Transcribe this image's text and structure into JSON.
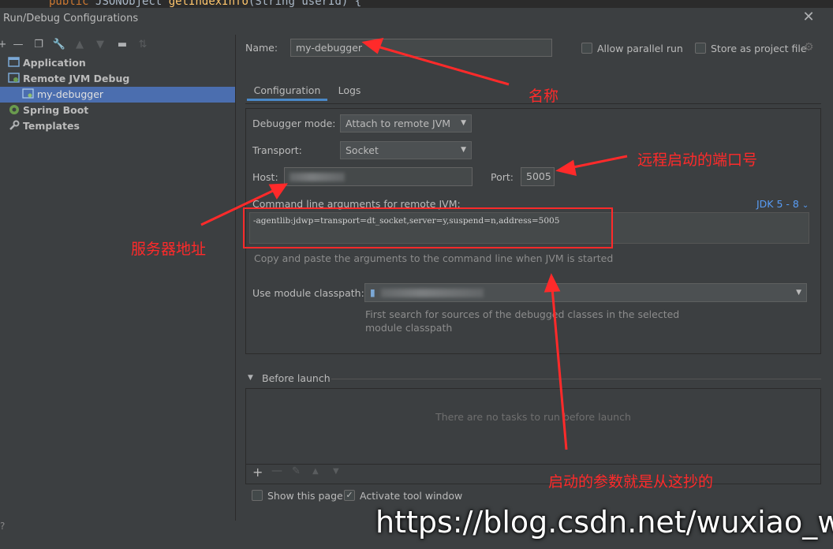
{
  "code_line": {
    "kw": "public",
    "type": "JSONObject",
    "fn": "getIndexInfo",
    "args": "(String userId) {"
  },
  "window": {
    "title": "Run/Debug Configurations"
  },
  "toolbar": {
    "icons": [
      "add-icon",
      "remove-icon",
      "copy-icon",
      "wrench-icon",
      "arrow-up-icon",
      "arrow-down-icon",
      "folder-icon",
      "sort-icon"
    ]
  },
  "tree": [
    {
      "label": "Application"
    },
    {
      "label": "Remote JVM Debug"
    },
    {
      "label": "my-debugger"
    },
    {
      "label": "Spring Boot"
    },
    {
      "label": "Templates"
    }
  ],
  "form": {
    "name_label": "Name:",
    "name_value": "my-debugger",
    "allow_parallel": "Allow parallel run",
    "store_project": "Store as project file",
    "tabs": [
      "Configuration",
      "Logs"
    ],
    "debugger_mode_label": "Debugger mode:",
    "debugger_mode_value": "Attach to remote JVM",
    "transport_label": "Transport:",
    "transport_value": "Socket",
    "host_label": "Host:",
    "port_label": "Port:",
    "port_value": "5005",
    "cmd_label": "Command line arguments for remote JVM:",
    "jdk_label": "JDK 5 - 8",
    "cmd_value": "-agentlib:jdwp=transport=dt_socket,server=y,suspend=n,address=5005",
    "cmd_hint": "Copy and paste the arguments to the command line when JVM is started",
    "module_label": "Use module classpath:",
    "module_hint_1": "First search for sources of the debugged classes in the selected",
    "module_hint_2": "module classpath",
    "before_launch": "Before launch",
    "no_tasks": "There are no tasks to run before launch",
    "show_page": "Show this page",
    "activate_tool": "Activate tool window"
  },
  "annotations": {
    "name": "名称",
    "port": "远程启动的端口号",
    "host": "服务器地址",
    "params": "启动的参数就是从这抄的"
  },
  "watermark": "https://blog.csdn.net/wuxiao_wei",
  "colors": {
    "accent": "#4a88c7",
    "selection": "#4b6eaf",
    "annotation": "#ff2a2a"
  }
}
